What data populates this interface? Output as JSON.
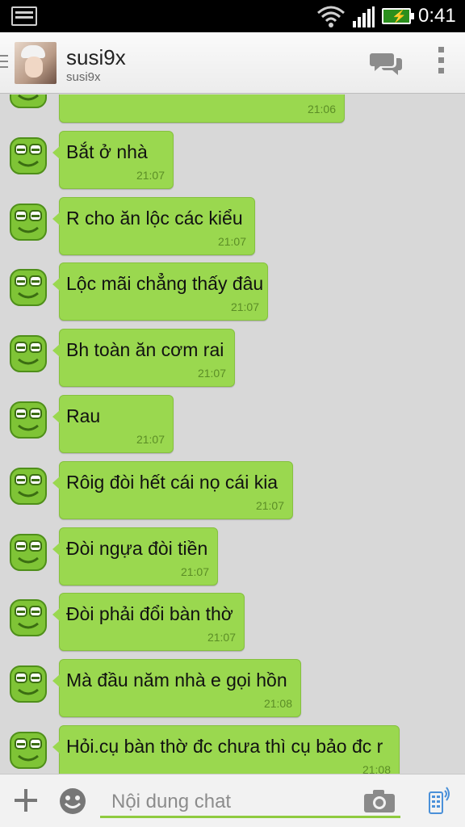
{
  "status_bar": {
    "time": "0:41"
  },
  "header": {
    "contact_name": "susi9x",
    "contact_username": "susi9x"
  },
  "messages": [
    {
      "text": "",
      "time": "21:06",
      "partial": true
    },
    {
      "text": "Bắt ở nhà",
      "time": "21:07"
    },
    {
      "text": "R cho ăn lộc các kiểu",
      "time": "21:07"
    },
    {
      "text": "Lộc mãi chẳng thấy đâu",
      "time": "21:07"
    },
    {
      "text": "Bh toàn ăn cơm rai",
      "time": "21:07"
    },
    {
      "text": "Rau",
      "time": "21:07"
    },
    {
      "text": "Rôig đòi hết cái nọ cái kia",
      "time": "21:07"
    },
    {
      "text": "Đòi ngựa đòi tiền",
      "time": "21:07"
    },
    {
      "text": "Đòi phải đổi bàn thờ",
      "time": "21:07"
    },
    {
      "text": "Mà đầu năm nhà e gọi hồn",
      "time": "21:08"
    },
    {
      "text": "Hỏi.cụ bàn thờ đc chưa thì cụ bảo đc r",
      "time": "21:08"
    }
  ],
  "input": {
    "placeholder": "Nội dung chat"
  },
  "colors": {
    "bubble": "#9ad84f",
    "accent": "#8fcb3f",
    "background": "#d8d8d8"
  },
  "icons": [
    "menu-icon",
    "wifi-icon",
    "signal-icon",
    "battery-icon",
    "chat-icon",
    "overflow-menu-icon",
    "add-icon",
    "emoji-icon",
    "camera-icon",
    "voice-icon"
  ]
}
